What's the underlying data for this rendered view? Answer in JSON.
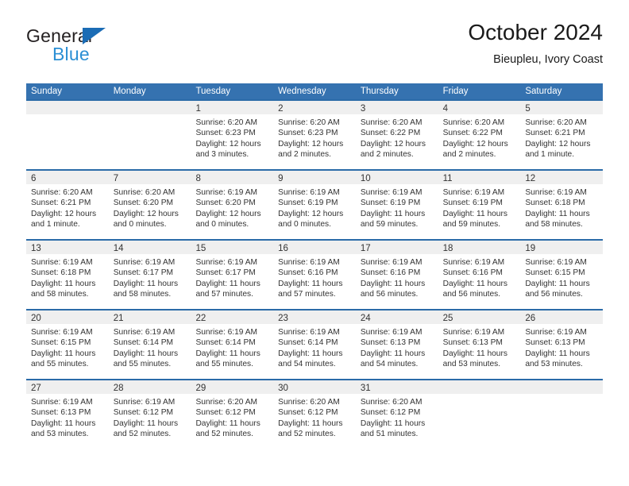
{
  "brand": {
    "name_part1": "General",
    "name_part2": "Blue",
    "triangle_color": "#1b6cb5",
    "blue_text_color": "#2b8fd4"
  },
  "header": {
    "title": "October 2024",
    "subtitle": "Bieupleu, Ivory Coast"
  },
  "theme": {
    "header_blue": "#3572b0",
    "row_border_blue": "#2b6ba8",
    "day_band_gray": "#efefef"
  },
  "weekdays": [
    "Sunday",
    "Monday",
    "Tuesday",
    "Wednesday",
    "Thursday",
    "Friday",
    "Saturday"
  ],
  "weeks": [
    [
      {
        "day": "",
        "sunrise": "",
        "sunset": "",
        "daylight_line1": "",
        "daylight_line2": ""
      },
      {
        "day": "",
        "sunrise": "",
        "sunset": "",
        "daylight_line1": "",
        "daylight_line2": ""
      },
      {
        "day": "1",
        "sunrise": "Sunrise: 6:20 AM",
        "sunset": "Sunset: 6:23 PM",
        "daylight_line1": "Daylight: 12 hours",
        "daylight_line2": "and 3 minutes."
      },
      {
        "day": "2",
        "sunrise": "Sunrise: 6:20 AM",
        "sunset": "Sunset: 6:23 PM",
        "daylight_line1": "Daylight: 12 hours",
        "daylight_line2": "and 2 minutes."
      },
      {
        "day": "3",
        "sunrise": "Sunrise: 6:20 AM",
        "sunset": "Sunset: 6:22 PM",
        "daylight_line1": "Daylight: 12 hours",
        "daylight_line2": "and 2 minutes."
      },
      {
        "day": "4",
        "sunrise": "Sunrise: 6:20 AM",
        "sunset": "Sunset: 6:22 PM",
        "daylight_line1": "Daylight: 12 hours",
        "daylight_line2": "and 2 minutes."
      },
      {
        "day": "5",
        "sunrise": "Sunrise: 6:20 AM",
        "sunset": "Sunset: 6:21 PM",
        "daylight_line1": "Daylight: 12 hours",
        "daylight_line2": "and 1 minute."
      }
    ],
    [
      {
        "day": "6",
        "sunrise": "Sunrise: 6:20 AM",
        "sunset": "Sunset: 6:21 PM",
        "daylight_line1": "Daylight: 12 hours",
        "daylight_line2": "and 1 minute."
      },
      {
        "day": "7",
        "sunrise": "Sunrise: 6:20 AM",
        "sunset": "Sunset: 6:20 PM",
        "daylight_line1": "Daylight: 12 hours",
        "daylight_line2": "and 0 minutes."
      },
      {
        "day": "8",
        "sunrise": "Sunrise: 6:19 AM",
        "sunset": "Sunset: 6:20 PM",
        "daylight_line1": "Daylight: 12 hours",
        "daylight_line2": "and 0 minutes."
      },
      {
        "day": "9",
        "sunrise": "Sunrise: 6:19 AM",
        "sunset": "Sunset: 6:19 PM",
        "daylight_line1": "Daylight: 12 hours",
        "daylight_line2": "and 0 minutes."
      },
      {
        "day": "10",
        "sunrise": "Sunrise: 6:19 AM",
        "sunset": "Sunset: 6:19 PM",
        "daylight_line1": "Daylight: 11 hours",
        "daylight_line2": "and 59 minutes."
      },
      {
        "day": "11",
        "sunrise": "Sunrise: 6:19 AM",
        "sunset": "Sunset: 6:19 PM",
        "daylight_line1": "Daylight: 11 hours",
        "daylight_line2": "and 59 minutes."
      },
      {
        "day": "12",
        "sunrise": "Sunrise: 6:19 AM",
        "sunset": "Sunset: 6:18 PM",
        "daylight_line1": "Daylight: 11 hours",
        "daylight_line2": "and 58 minutes."
      }
    ],
    [
      {
        "day": "13",
        "sunrise": "Sunrise: 6:19 AM",
        "sunset": "Sunset: 6:18 PM",
        "daylight_line1": "Daylight: 11 hours",
        "daylight_line2": "and 58 minutes."
      },
      {
        "day": "14",
        "sunrise": "Sunrise: 6:19 AM",
        "sunset": "Sunset: 6:17 PM",
        "daylight_line1": "Daylight: 11 hours",
        "daylight_line2": "and 58 minutes."
      },
      {
        "day": "15",
        "sunrise": "Sunrise: 6:19 AM",
        "sunset": "Sunset: 6:17 PM",
        "daylight_line1": "Daylight: 11 hours",
        "daylight_line2": "and 57 minutes."
      },
      {
        "day": "16",
        "sunrise": "Sunrise: 6:19 AM",
        "sunset": "Sunset: 6:16 PM",
        "daylight_line1": "Daylight: 11 hours",
        "daylight_line2": "and 57 minutes."
      },
      {
        "day": "17",
        "sunrise": "Sunrise: 6:19 AM",
        "sunset": "Sunset: 6:16 PM",
        "daylight_line1": "Daylight: 11 hours",
        "daylight_line2": "and 56 minutes."
      },
      {
        "day": "18",
        "sunrise": "Sunrise: 6:19 AM",
        "sunset": "Sunset: 6:16 PM",
        "daylight_line1": "Daylight: 11 hours",
        "daylight_line2": "and 56 minutes."
      },
      {
        "day": "19",
        "sunrise": "Sunrise: 6:19 AM",
        "sunset": "Sunset: 6:15 PM",
        "daylight_line1": "Daylight: 11 hours",
        "daylight_line2": "and 56 minutes."
      }
    ],
    [
      {
        "day": "20",
        "sunrise": "Sunrise: 6:19 AM",
        "sunset": "Sunset: 6:15 PM",
        "daylight_line1": "Daylight: 11 hours",
        "daylight_line2": "and 55 minutes."
      },
      {
        "day": "21",
        "sunrise": "Sunrise: 6:19 AM",
        "sunset": "Sunset: 6:14 PM",
        "daylight_line1": "Daylight: 11 hours",
        "daylight_line2": "and 55 minutes."
      },
      {
        "day": "22",
        "sunrise": "Sunrise: 6:19 AM",
        "sunset": "Sunset: 6:14 PM",
        "daylight_line1": "Daylight: 11 hours",
        "daylight_line2": "and 55 minutes."
      },
      {
        "day": "23",
        "sunrise": "Sunrise: 6:19 AM",
        "sunset": "Sunset: 6:14 PM",
        "daylight_line1": "Daylight: 11 hours",
        "daylight_line2": "and 54 minutes."
      },
      {
        "day": "24",
        "sunrise": "Sunrise: 6:19 AM",
        "sunset": "Sunset: 6:13 PM",
        "daylight_line1": "Daylight: 11 hours",
        "daylight_line2": "and 54 minutes."
      },
      {
        "day": "25",
        "sunrise": "Sunrise: 6:19 AM",
        "sunset": "Sunset: 6:13 PM",
        "daylight_line1": "Daylight: 11 hours",
        "daylight_line2": "and 53 minutes."
      },
      {
        "day": "26",
        "sunrise": "Sunrise: 6:19 AM",
        "sunset": "Sunset: 6:13 PM",
        "daylight_line1": "Daylight: 11 hours",
        "daylight_line2": "and 53 minutes."
      }
    ],
    [
      {
        "day": "27",
        "sunrise": "Sunrise: 6:19 AM",
        "sunset": "Sunset: 6:13 PM",
        "daylight_line1": "Daylight: 11 hours",
        "daylight_line2": "and 53 minutes."
      },
      {
        "day": "28",
        "sunrise": "Sunrise: 6:19 AM",
        "sunset": "Sunset: 6:12 PM",
        "daylight_line1": "Daylight: 11 hours",
        "daylight_line2": "and 52 minutes."
      },
      {
        "day": "29",
        "sunrise": "Sunrise: 6:20 AM",
        "sunset": "Sunset: 6:12 PM",
        "daylight_line1": "Daylight: 11 hours",
        "daylight_line2": "and 52 minutes."
      },
      {
        "day": "30",
        "sunrise": "Sunrise: 6:20 AM",
        "sunset": "Sunset: 6:12 PM",
        "daylight_line1": "Daylight: 11 hours",
        "daylight_line2": "and 52 minutes."
      },
      {
        "day": "31",
        "sunrise": "Sunrise: 6:20 AM",
        "sunset": "Sunset: 6:12 PM",
        "daylight_line1": "Daylight: 11 hours",
        "daylight_line2": "and 51 minutes."
      },
      {
        "day": "",
        "sunrise": "",
        "sunset": "",
        "daylight_line1": "",
        "daylight_line2": ""
      },
      {
        "day": "",
        "sunrise": "",
        "sunset": "",
        "daylight_line1": "",
        "daylight_line2": ""
      }
    ]
  ]
}
